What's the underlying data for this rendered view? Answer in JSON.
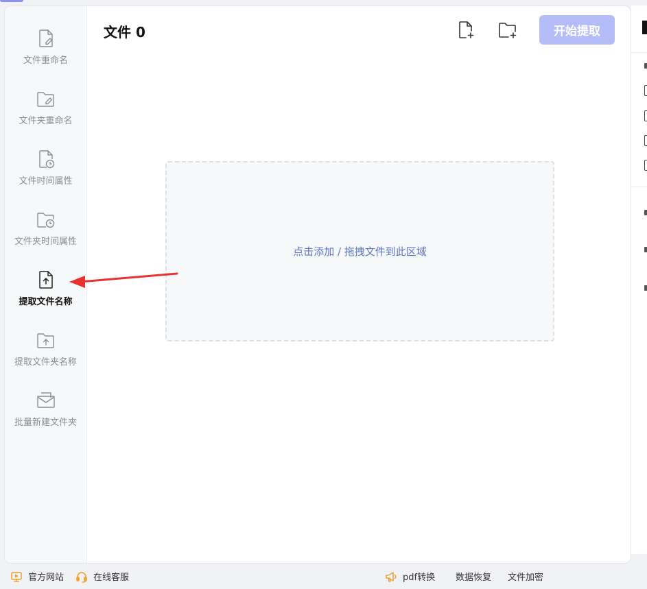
{
  "sidebar": {
    "items": [
      {
        "label": "文件重命名",
        "icon": "file-edit-icon",
        "active": false
      },
      {
        "label": "文件夹重命名",
        "icon": "folder-edit-icon",
        "active": false
      },
      {
        "label": "文件时间属性",
        "icon": "file-clock-icon",
        "active": false
      },
      {
        "label": "文件夹时间属性",
        "icon": "folder-clock-icon",
        "active": false
      },
      {
        "label": "提取文件名称",
        "icon": "file-upload-icon",
        "active": true
      },
      {
        "label": "提取文件夹名称",
        "icon": "folder-upload-icon",
        "active": false
      },
      {
        "label": "批量新建文件夹",
        "icon": "envelope-icon",
        "active": false
      }
    ]
  },
  "main": {
    "file_count_label": "文件 0",
    "start_button_label": "开始提取",
    "drop_zone_text": "点击添加 / 拖拽文件到此区域"
  },
  "footer": {
    "official_site": "官方网站",
    "online_service": "在线客服",
    "pdf_convert": "pdf转换",
    "data_recovery": "数据恢复",
    "file_encrypt": "文件加密"
  },
  "colors": {
    "accent": "#b4bdf8",
    "drop_text": "#5d77c2",
    "annotation_arrow": "#e8322f",
    "footer_icon": "#f0a030"
  }
}
